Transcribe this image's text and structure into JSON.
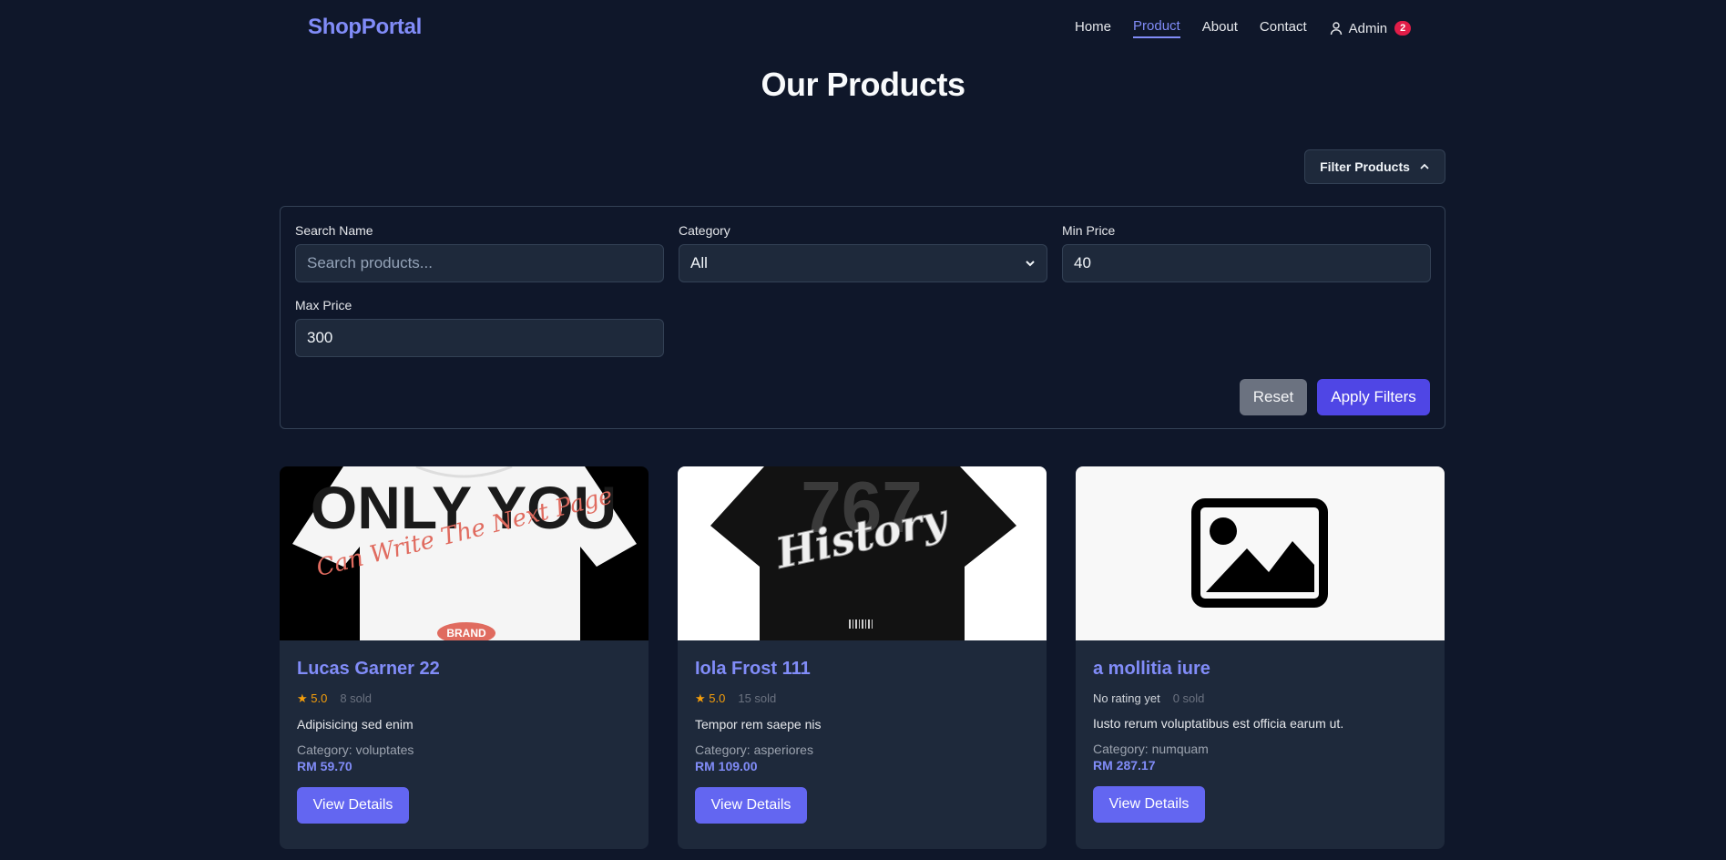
{
  "nav": {
    "brand": "ShopPortal",
    "links": [
      {
        "label": "Home",
        "active": false
      },
      {
        "label": "Product",
        "active": true
      },
      {
        "label": "About",
        "active": false
      },
      {
        "label": "Contact",
        "active": false
      }
    ],
    "admin_label": "Admin",
    "admin_badge": "2"
  },
  "page_title": "Our Products",
  "filter_toggle_label": "Filter Products",
  "filters": {
    "search": {
      "label": "Search Name",
      "placeholder": "Search products...",
      "value": ""
    },
    "category": {
      "label": "Category",
      "value": "All"
    },
    "min_price": {
      "label": "Min Price",
      "value": "40"
    },
    "max_price": {
      "label": "Max Price",
      "value": "300"
    },
    "reset_label": "Reset",
    "apply_label": "Apply Filters"
  },
  "products": [
    {
      "name": "Lucas Garner 22",
      "rating": "★ 5.0",
      "sold": "8 sold",
      "description": "Adipisicing sed enim",
      "category": "Category: voluptates",
      "price": "RM 59.70",
      "button": "View Details",
      "image_script": "Can Write The Next Page",
      "image_block": "ONLY YOU",
      "image_logo": "BRAND"
    },
    {
      "name": "Iola Frost 111",
      "rating": "★ 5.0",
      "sold": "15 sold",
      "description": "Tempor rem saepe nis",
      "category": "Category: asperiores",
      "price": "RM 109.00",
      "button": "View Details",
      "image_script": "History",
      "image_block": "767"
    },
    {
      "name": "a mollitia iure",
      "rating": "No rating yet",
      "sold": "0 sold",
      "description": "Iusto rerum voluptatibus est officia earum ut.",
      "category": "Category: numquam",
      "price": "RM 287.17",
      "button": "View Details"
    }
  ],
  "colors": {
    "background": "#0f172a",
    "card": "#1e293b",
    "accent": "#818cf8",
    "primary_button": "#4f46e5",
    "star": "#f59e0b",
    "badge": "#e11d48"
  },
  "icons": [
    "user-icon",
    "chevron-up-icon",
    "chevron-down-icon",
    "image-placeholder-icon"
  ]
}
